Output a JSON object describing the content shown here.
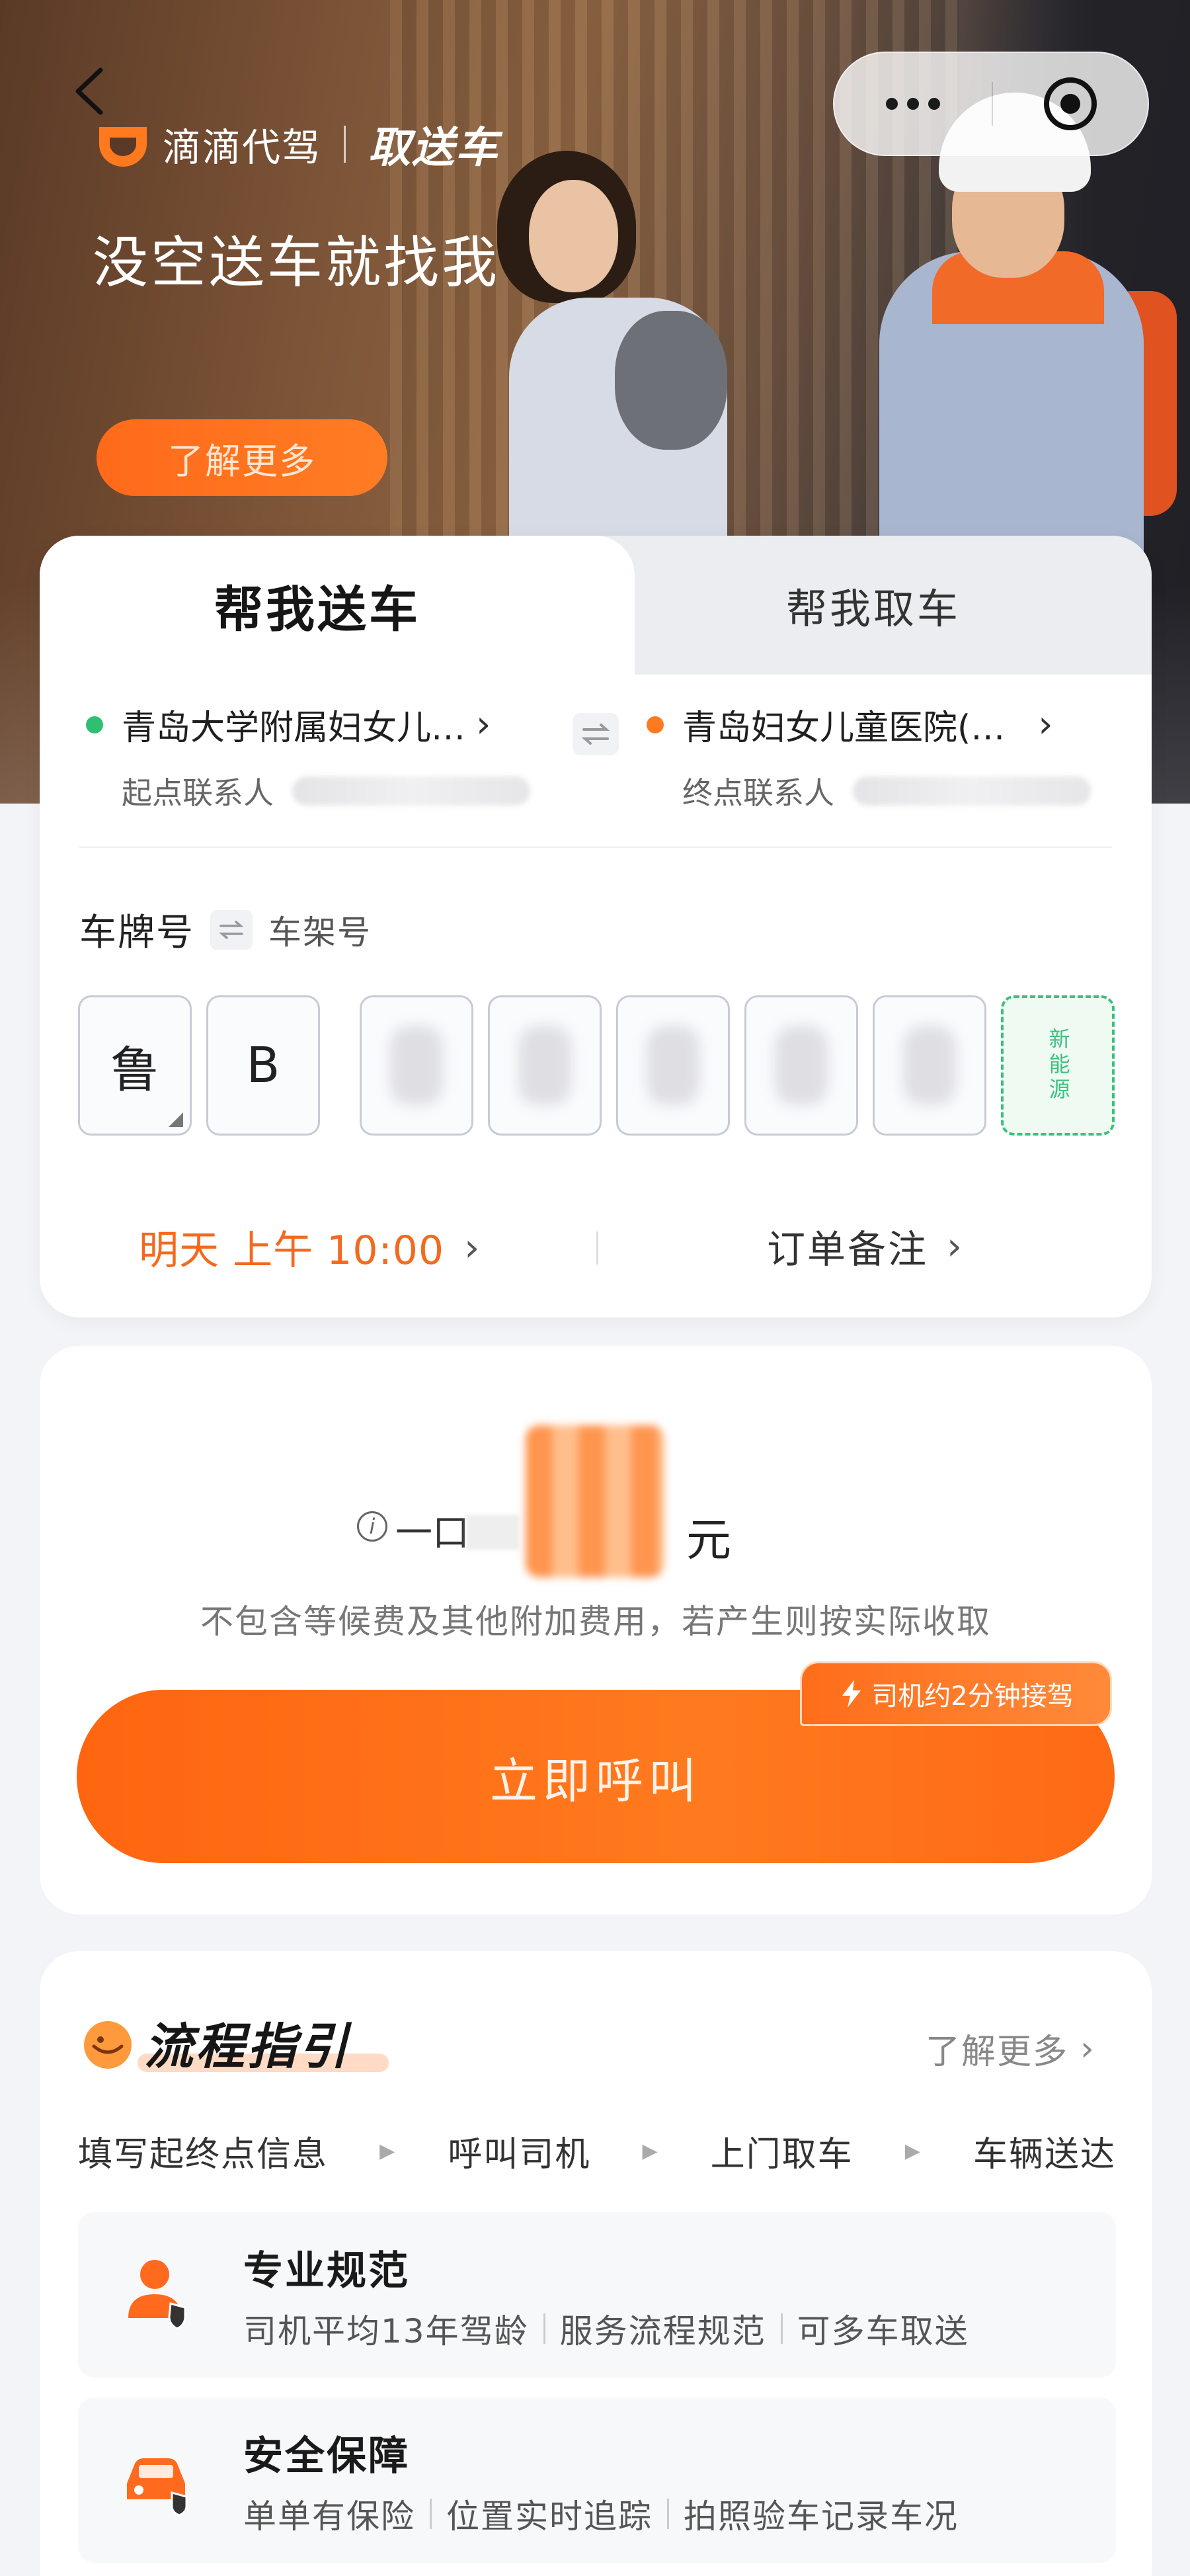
{
  "header": {
    "brand_name": "滴滴代驾",
    "service_name": "取送车",
    "slogan": "没空送车就找我",
    "learn_more_button": "了解更多"
  },
  "tabs": [
    {
      "label": "帮我送车",
      "active": true
    },
    {
      "label": "帮我取车",
      "active": false
    }
  ],
  "route": {
    "start_address": "青岛大学附属妇女儿…",
    "start_contact_label": "起点联系人",
    "end_address": "青岛妇女儿童医院(…",
    "end_contact_label": "终点联系人"
  },
  "plate": {
    "title": "车牌号",
    "alt_label": "车架号",
    "province": "鲁",
    "letter": "B",
    "new_energy_label": "新能源"
  },
  "schedule": {
    "time": "明天 上午 10:00",
    "note_label": "订单备注"
  },
  "price": {
    "prefix": "一口",
    "unit": "元",
    "disclaimer": "不包含等候费及其他附加费用，若产生则按实际收取"
  },
  "call": {
    "button_label": "立即呼叫",
    "eta_tag": "司机约2分钟接驾"
  },
  "process": {
    "title": "流程指引",
    "more_label": "了解更多",
    "steps": [
      "填写起终点信息",
      "呼叫司机",
      "上门取车",
      "车辆送达"
    ],
    "features": [
      {
        "title": "专业规范",
        "points": [
          "司机平均13年驾龄",
          "服务流程规范",
          "可多车取送"
        ],
        "icon": "driver-shield-icon"
      },
      {
        "title": "安全保障",
        "points": [
          "单单有保险",
          "位置实时追踪",
          "拍照验车记录车况"
        ],
        "icon": "car-shield-icon"
      }
    ]
  },
  "colors": {
    "accent": "#ff6a14",
    "start_dot": "#2fbf71",
    "end_dot": "#ff7a1e",
    "new_energy": "#3fbf7f"
  }
}
